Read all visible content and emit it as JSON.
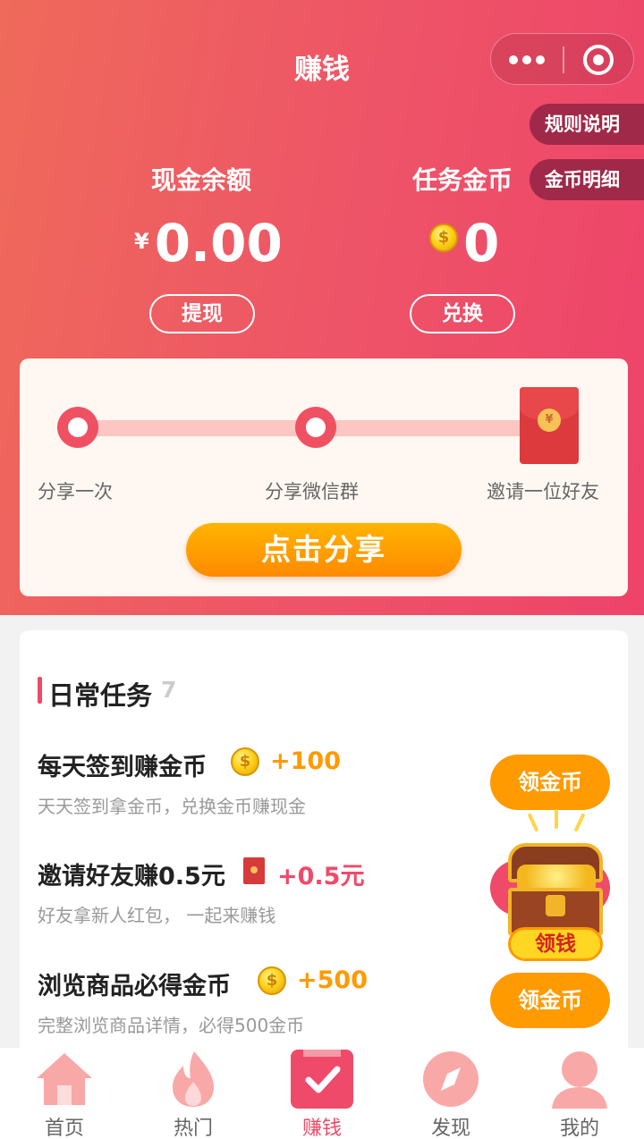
{
  "header": {
    "title": "赚钱",
    "side_tabs": [
      "规则说明",
      "金币明细"
    ]
  },
  "balance": {
    "cash_label": "现金余额",
    "cash_currency": "¥",
    "cash_value": "0.00",
    "withdraw_label": "提现",
    "coins_label": "任务金币",
    "coins_value": "0",
    "exchange_label": "兑换"
  },
  "share_progress": {
    "steps": [
      "分享一次",
      "分享微信群",
      "邀请一位好友"
    ],
    "packet_symbol": "¥",
    "button_label": "点击分享"
  },
  "daily_tasks": {
    "title": "日常任务",
    "count": "7",
    "items": [
      {
        "title": "每天签到赚金币",
        "reward": "+100",
        "subtitle": "天天签到拿金币，兑换金币赚现金",
        "button": "领金币"
      },
      {
        "title": "邀请好友赚0.5元",
        "reward": "+0.5元",
        "subtitle": "好友拿新人红包，  一起来赚钱",
        "button": ""
      },
      {
        "title": "浏览商品必得金币",
        "reward": "+500",
        "subtitle": "完整浏览商品详情，必得500金币",
        "button": "领金币"
      }
    ],
    "chest_label": "领钱"
  },
  "tabbar": {
    "items": [
      "首页",
      "热门",
      "赚钱",
      "发现",
      "我的"
    ],
    "active_index": 2
  },
  "colors": {
    "accent": "#ef4a6a",
    "orange": "#ff9a00",
    "hero_start": "#ef6a5a",
    "hero_end": "#ee436a"
  }
}
